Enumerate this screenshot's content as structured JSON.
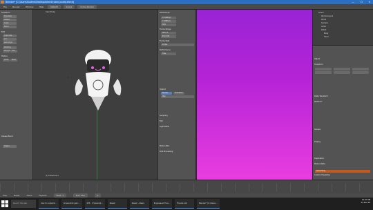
{
  "window": {
    "title": "Blender* [C:\\Users\\Student\\Desktop\\blend\\robot_buddy.blend]",
    "controls": [
      "—",
      "❐",
      "✕"
    ]
  },
  "menubar": {
    "items": [
      "File",
      "Render",
      "Window",
      "Help"
    ],
    "layout": "Default",
    "scene": "Scene",
    "engine": "Cycles Render"
  },
  "toolshelf": {
    "sections": [
      "Transform",
      "Edit",
      "History",
      "Grease Pencil"
    ],
    "buttons": [
      "Translate",
      "Rotate",
      "Scale",
      "Mirror",
      "Duplicate",
      "Join",
      "Set Origin",
      "Shading",
      "Smooth",
      "Flat",
      "Undo",
      "Redo",
      "Toggle"
    ]
  },
  "viewport": {
    "title": "User Persp",
    "footer": "(1) Camera.017"
  },
  "render_panel": {
    "sections": [
      "Dimensions",
      "Resolution",
      "Frame Range",
      "Frame Rate",
      "Performance",
      "Output",
      "Sampling",
      "Film",
      "Light Paths",
      "Motion Blur",
      "Post Processing"
    ],
    "fields": [
      "X: 1920 px",
      "Y: 1080 px",
      "50%",
      "Start: 1",
      "End: 250",
      "24 fps",
      "Tiles",
      "Render",
      "Animation",
      "Audio"
    ],
    "buttons": [
      "Render",
      "Animation",
      "Play"
    ]
  },
  "outliner": {
    "items": [
      "Scene",
      "RenderLayers",
      "World",
      "Camera",
      "Lamp",
      "Robot",
      "Body",
      "Head"
    ]
  },
  "properties": {
    "sections": [
      "Object",
      "Transform",
      "Delta Transform",
      "Relations",
      "Groups",
      "Display",
      "Duplication",
      "Motion Paths",
      "Custom Properties"
    ],
    "active_name": "Robot Body"
  },
  "timeline": {
    "items": [
      "View",
      "Marker",
      "Frame",
      "Playback",
      "Start: 1",
      "End: 250",
      "1"
    ]
  },
  "taskbar": {
    "search_placeholder": "Search the web",
    "tasks": [
      "how to outpaint...",
      "Screenshot gam...",
      "SFE - C:\\Users\\S...",
      "Steam",
      "Steam - News",
      "Engineered Fina...",
      "Friends List",
      "Blender* [C:\\Users..."
    ],
    "time": "10:47 PM",
    "date": "23-Nov-16"
  }
}
